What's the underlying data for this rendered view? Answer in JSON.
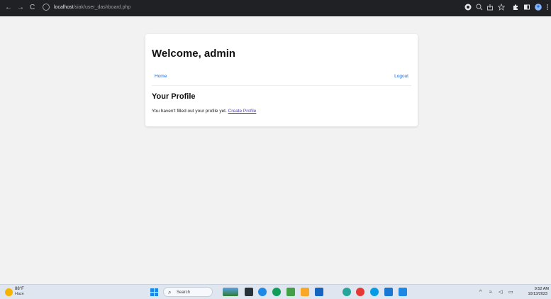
{
  "browser": {
    "url_host": "localhost",
    "url_path": "/siak/user_dashboard.php"
  },
  "page": {
    "welcome_title": "Welcome, admin",
    "nav": {
      "home_label": "Home",
      "logout_label": "Logout"
    },
    "profile_heading": "Your Profile",
    "profile_message": "You haven't filled out your profile yet.",
    "create_profile_label": "Create Profile"
  },
  "taskbar": {
    "weather_temp": "88°F",
    "weather_condition": "Haze",
    "search_label": "Search",
    "clock_time": "9:52 AM",
    "clock_date": "10/13/2023"
  },
  "colors": {
    "link": "#1a66d6",
    "visited_link": "#4b3fa8",
    "page_background": "#f2f2f2"
  }
}
